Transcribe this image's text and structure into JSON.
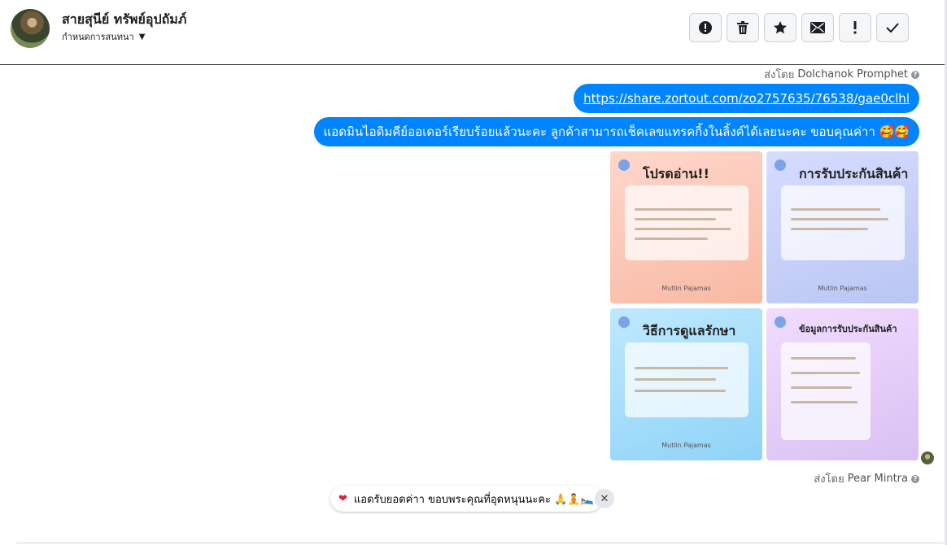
{
  "header": {
    "contact_name": "สายสุนีย์ ทรัพย์อุปถัมภ์",
    "assign_label": "กำหนดการสนทนา",
    "toolbar_icons": [
      "alert-circle-icon",
      "trash-icon",
      "star-icon",
      "envelope-icon",
      "exclamation-icon",
      "check-icon"
    ]
  },
  "messages": {
    "sent_by_1": {
      "prefix": "ส่งโดย",
      "name": "Dolchanok Promphet"
    },
    "link": "https://share.zortout.com/zo2757635/76538/gae0clhl",
    "text": "แอดมินไอดิมคีย์ออเดอร์เรียบร้อยแล้วนะคะ ลูกค้าสามารถเช็คเลขแทรคกิ้งในลิ้งค์ได้เลยนะคะ ขอบคุณค่าา 🥰🥰",
    "images": [
      {
        "title": "โปรดอ่าน!!",
        "footer": "Mutlin Pajamas"
      },
      {
        "title": "การรับประกันสินค้า",
        "footer": "Mutlin Pajamas"
      },
      {
        "title": "วิธีการดูแลรักษา",
        "footer": "Mutlin Pajamas"
      },
      {
        "title": "ข้อมูลการรับประกันสินค้า",
        "footer": ""
      }
    ],
    "sent_by_2": {
      "prefix": "ส่งโดย",
      "name": "Pear Mintra"
    }
  },
  "quick_reply": {
    "text": "แอดรับยอดค่าา ขอบพระคุณที่อุดหนุนนะคะ 🙏🧘🛌",
    "close_symbol": "✕"
  },
  "colors": {
    "bubble": "#0084ff",
    "heart": "#e41e3f"
  }
}
